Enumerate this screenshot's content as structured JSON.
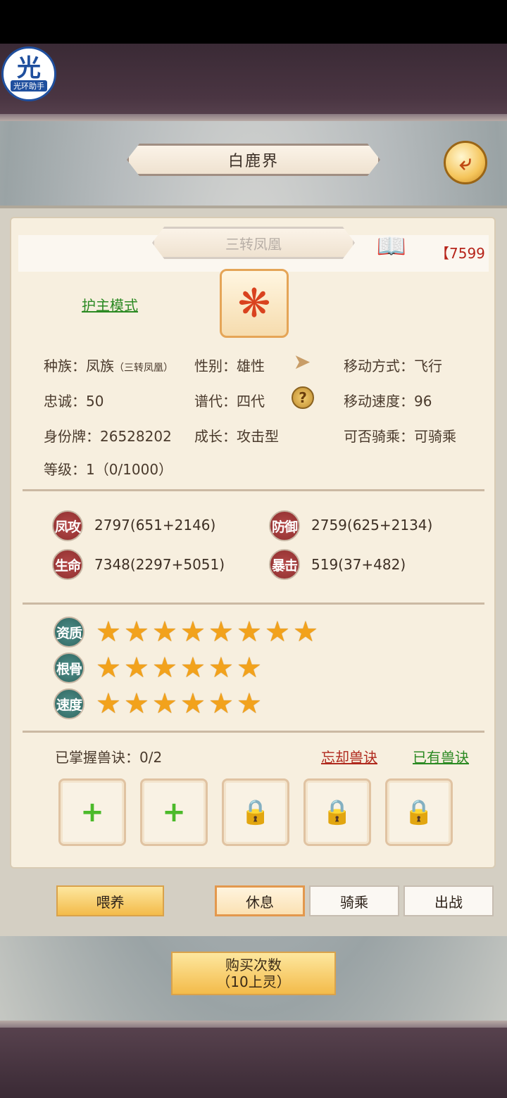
{
  "app_badge": {
    "glyph": "光",
    "caption": "光环助手"
  },
  "header": {
    "title": "白鹿界",
    "back_icon": "back-arrow-icon"
  },
  "pet": {
    "name": "三转凤凰",
    "id_tag": "【7599",
    "mode_link": "护主模式",
    "info": {
      "race_label": "种族：",
      "race_value": "凤族",
      "race_sub": "（三转凤凰）",
      "gender_label": "性别：",
      "gender_value": "雄性",
      "move_mode_label": "移动方式：",
      "move_mode_value": "飞行",
      "loyalty_label": "忠诚：",
      "loyalty_value": "50",
      "generation_label": "谱代：",
      "generation_value": "四代",
      "move_speed_label": "移动速度：",
      "move_speed_value": "96",
      "identity_label": "身份牌：",
      "identity_value": "26528202",
      "growth_label": "成长：",
      "growth_value": "攻击型",
      "rideable_label": "可否骑乘：",
      "rideable_value": "可骑乘",
      "level_label": "等级：",
      "level_value": "1（0/1000）"
    }
  },
  "stats": [
    {
      "badge": "凤攻",
      "value": "2797(651+2146)"
    },
    {
      "badge": "防御",
      "value": "2759(625+2134)"
    },
    {
      "badge": "生命",
      "value": "7348(2297+5051)"
    },
    {
      "badge": "暴击",
      "value": "519(37+482)"
    }
  ],
  "ratings": [
    {
      "badge": "资质",
      "stars": 8
    },
    {
      "badge": "根骨",
      "stars": 6
    },
    {
      "badge": "速度",
      "stars": 6
    }
  ],
  "skills": {
    "title": "已掌握兽诀：0/2",
    "forget_link": "忘却兽诀",
    "owned_link": "已有兽诀",
    "slots": [
      "add",
      "add",
      "locked",
      "locked",
      "locked"
    ]
  },
  "actions": {
    "feed": "喂养",
    "rest": "休息",
    "ride": "骑乘",
    "battle": "出战"
  },
  "buy": {
    "line1": "购买次数",
    "line2": "（10上灵）"
  }
}
